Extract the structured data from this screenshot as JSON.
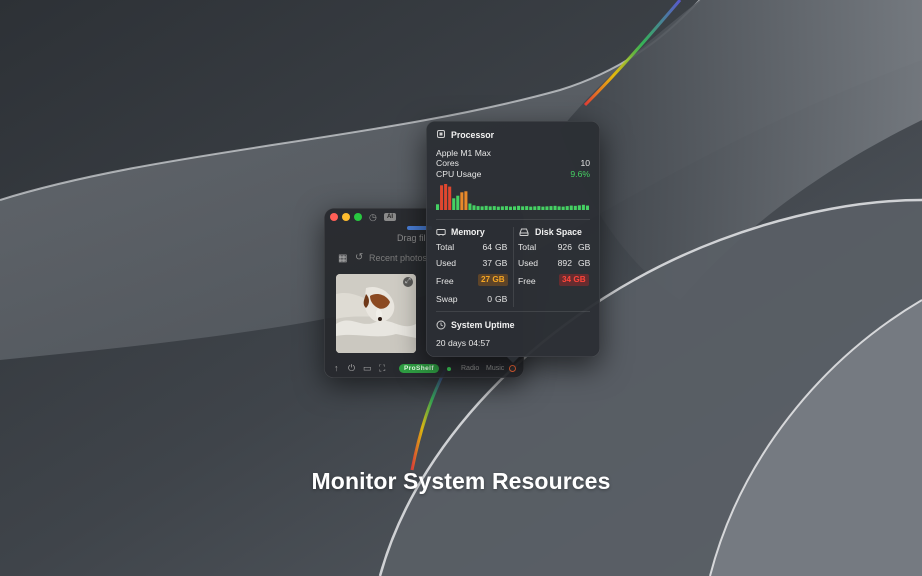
{
  "headline": "Monitor System Resources",
  "colors": {
    "accent_green": "#45d163",
    "warning_orange": "#f5a623",
    "danger_red": "#ff453a",
    "proshelf_green": "#2f9e43"
  },
  "app_window": {
    "badge": "AI",
    "drag_label": "Drag fil",
    "recent_label": "Recent photos",
    "proshelf_label": "ProShelf",
    "tabs": [
      "Radio",
      "Music"
    ],
    "icons": [
      "grid-icon",
      "history-icon",
      "arrow-up-icon",
      "power-icon",
      "folder-icon",
      "screenshot-icon",
      "expand-icon",
      "gauge-icon"
    ]
  },
  "stats": {
    "processor": {
      "title": "Processor",
      "chip": "Apple M1 Max",
      "cores_label": "Cores",
      "cores_value": "10",
      "usage_label": "CPU Usage",
      "usage_value": "9.6%",
      "history": [
        0.22,
        0.95,
        1.0,
        0.9,
        0.45,
        0.55,
        0.68,
        0.72,
        0.25,
        0.18,
        0.15,
        0.14,
        0.16,
        0.14,
        0.15,
        0.13,
        0.14,
        0.15,
        0.13,
        0.14,
        0.16,
        0.14,
        0.15,
        0.13,
        0.14,
        0.15,
        0.13,
        0.14,
        0.15,
        0.16,
        0.14,
        0.13,
        0.15,
        0.17,
        0.16,
        0.18,
        0.2,
        0.17
      ]
    },
    "memory": {
      "title": "Memory",
      "total_label": "Total",
      "total_value": "64",
      "total_unit": "GB",
      "used_label": "Used",
      "used_value": "37",
      "used_unit": "GB",
      "free_label": "Free",
      "free_value": "27 GB",
      "swap_label": "Swap",
      "swap_value": "0",
      "swap_unit": "GB"
    },
    "disk": {
      "title": "Disk Space",
      "total_label": "Total",
      "total_value": "926",
      "total_unit": "GB",
      "used_label": "Used",
      "used_value": "892",
      "used_unit": "GB",
      "free_label": "Free",
      "free_value": "34 GB"
    },
    "uptime": {
      "title": "System Uptime",
      "value": "20 days 04:57"
    }
  }
}
